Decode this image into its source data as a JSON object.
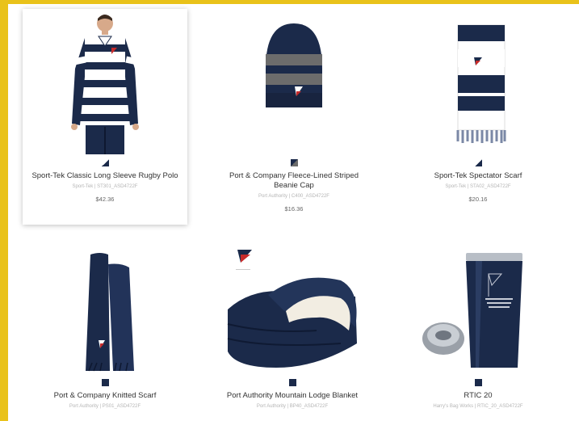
{
  "products": [
    {
      "name": "Sport-Tek Classic Long Sleeve Rugby Polo",
      "sku": "Sport-Tek | ST301_ASD4722F",
      "price": "$42.36",
      "swatch": "#1b2a4a"
    },
    {
      "name": "Port & Company Fleece-Lined Striped Beanie Cap",
      "sku": "Port Authority | C400_ASD4722F",
      "price": "$16.36",
      "swatch": "#1b2a4a"
    },
    {
      "name": "Sport-Tek Spectator Scarf",
      "sku": "Sport-Tek | STA02_ASD4722F",
      "price": "$20.16",
      "swatch": "#1b2a4a"
    },
    {
      "name": "Port & Company Knitted Scarf",
      "sku": "Port Authority | PS01_ASD4722F",
      "price": "",
      "swatch": "#1b2a4a"
    },
    {
      "name": "Port Authority Mountain Lodge Blanket",
      "sku": "Port Authority | BP40_ASD4722F",
      "price": "",
      "swatch": "#1b2a4a"
    },
    {
      "name": "RTIC 20",
      "sku": "Harry's Bag Works | RTIC_20_ASD4722F",
      "price": "",
      "swatch": "#1b2a4a"
    }
  ],
  "colors": {
    "frame": "#e9c21a",
    "navy": "#1b2a4a",
    "white": "#ffffff",
    "gray": "#777777"
  }
}
